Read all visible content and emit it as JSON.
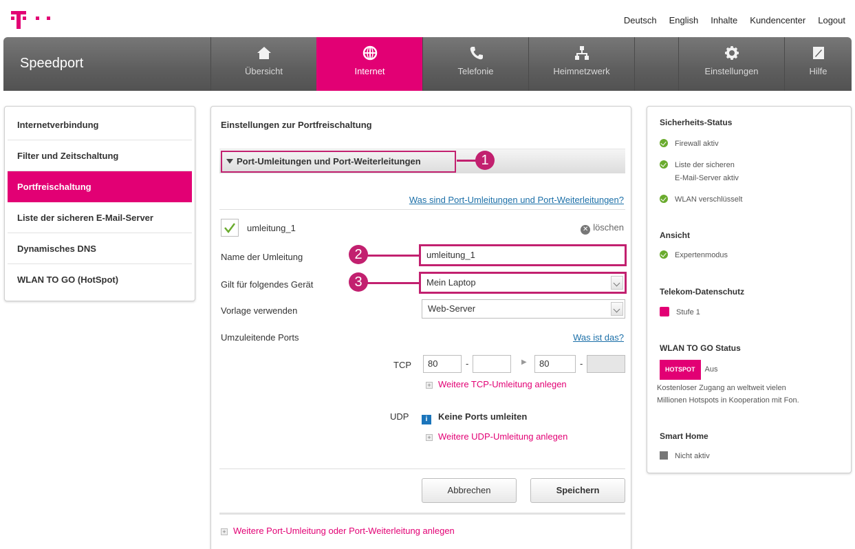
{
  "top_links": [
    "Deutsch",
    "English",
    "Inhalte",
    "Kundencenter",
    "Logout"
  ],
  "brand": "Speedport",
  "nav": [
    {
      "label": "Übersicht",
      "icon": "home-icon"
    },
    {
      "label": "Internet",
      "icon": "globe-icon",
      "active": true
    },
    {
      "label": "Telefonie",
      "icon": "phone-icon"
    },
    {
      "label": "Heimnetzwerk",
      "icon": "network-icon"
    },
    {
      "label": "Einstellungen",
      "icon": "gear-icon"
    },
    {
      "label": "Hilfe",
      "icon": "help-icon"
    }
  ],
  "sidebar": [
    "Internetverbindung",
    "Filter und Zeitschaltung",
    "Portfreischaltung",
    "Liste der sicheren E-Mail-Server",
    "Dynamisches DNS",
    "WLAN TO GO (HotSpot)"
  ],
  "main": {
    "title": "Einstellungen zur Portfreischaltung",
    "section": "Port-Umleitungen und Port-Weiterleitungen",
    "help_link": "Was sind Port-Umleitungen und Port-Weiterleitungen?",
    "rule_name": "umleitung_1",
    "delete": "löschen",
    "fields": {
      "name_label": "Name der Umleitung",
      "name_value": "umleitung_1",
      "device_label": "Gilt für folgendes Gerät",
      "device_value": "Mein Laptop",
      "template_label": "Vorlage verwenden",
      "template_value": "Web-Server",
      "ports_label": "Umzuleitende Ports",
      "ports_help": "Was ist das?"
    },
    "tcp": {
      "label": "TCP",
      "from1": "80",
      "to1": "",
      "from2": "80",
      "to2": ""
    },
    "tcp_add": "Weitere TCP-Umleitung anlegen",
    "udp": {
      "label": "UDP",
      "info": "Keine Ports umleiten"
    },
    "udp_add": "Weitere UDP-Umleitung anlegen",
    "cancel": "Abbrechen",
    "save": "Speichern",
    "add_more": "Weitere Port-Umleitung oder Port-Weiterleitung anlegen",
    "callouts": [
      "1",
      "2",
      "3"
    ]
  },
  "right": {
    "security_title": "Sicherheits-Status",
    "security_items": [
      "Firewall aktiv",
      "Liste der sicheren",
      "E-Mail-Server aktiv",
      "WLAN verschlüsselt"
    ],
    "view_title": "Ansicht",
    "view_item": "Expertenmodus",
    "privacy_title": "Telekom-Datenschutz",
    "privacy_item": "Stufe 1",
    "wlan_title": "WLAN TO GO Status",
    "hotspot_badge": "HOTSPOT",
    "hotspot_state": "Aus",
    "wlan_desc_1": "Kostenloser Zugang an weltweit vielen",
    "wlan_desc_2": "Millionen Hotspots in Kooperation mit Fon.",
    "smarthome_title": "Smart Home",
    "smarthome_item": "Nicht aktiv"
  },
  "colors": {
    "magenta": "#e20074",
    "callout": "#c2206f",
    "nav_gray": "#5e5e5e",
    "link_blue": "#1b6fa8",
    "ok_green": "#6aab2e"
  }
}
